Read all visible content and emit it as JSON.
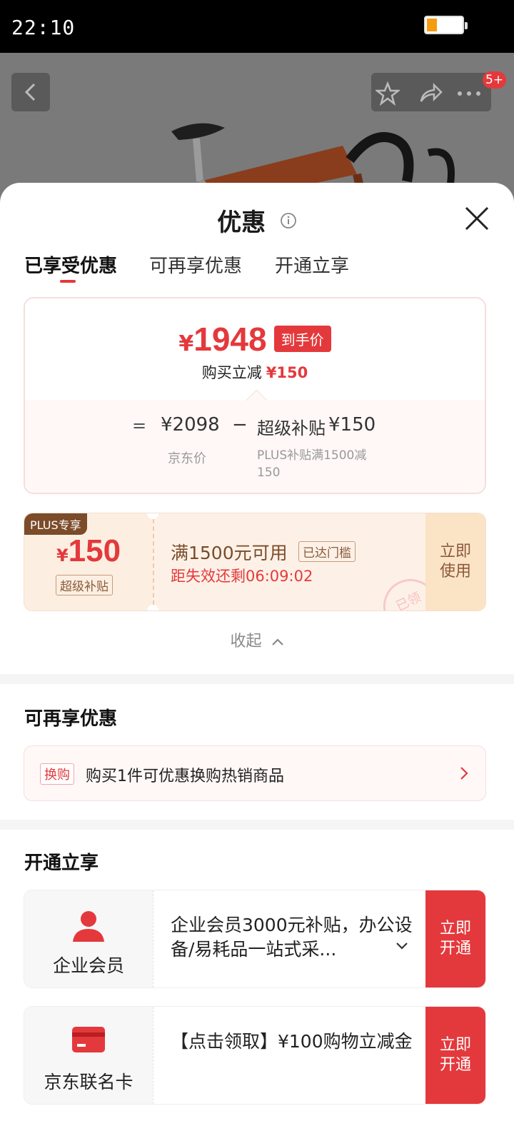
{
  "status_bar": {
    "time": "22:10"
  },
  "product_header": {
    "cart_badge": "5+"
  },
  "sheet": {
    "title": "优惠",
    "tabs": [
      {
        "label": "已享受优惠"
      },
      {
        "label": "可再享优惠"
      },
      {
        "label": "开通立享"
      }
    ],
    "price_card": {
      "currency": "¥",
      "final_price": "1948",
      "final_tag": "到手价",
      "instant_label": "购买立减",
      "instant_amount": "¥150",
      "equals": "=",
      "original_price": "¥2098",
      "minus": "−",
      "subsidy_name": "超级补贴",
      "subsidy_amount": "¥150",
      "original_label": "京东价",
      "subsidy_desc": "PLUS补贴满1500减150"
    },
    "coupon": {
      "plus_tag": "PLUS专享",
      "currency": "¥",
      "amount": "150",
      "type": "超级补贴",
      "condition": "满1500元可用",
      "reached": "已达门槛",
      "timer": "距失效还剩06:09:02",
      "stamp": "已领",
      "use_label": "立即使用"
    },
    "collapse_label": "收起",
    "more_section": {
      "title": "可再享优惠",
      "swap_tag": "换购",
      "swap_text": "购买1件可优惠换购热销商品"
    },
    "open_section": {
      "title": "开通立享",
      "items": [
        {
          "name": "企业会员",
          "desc": "企业会员3000元补贴，办公设备/易耗品一站式采...",
          "button": "立即开通"
        },
        {
          "name": "京东联名卡",
          "desc": "【点击领取】¥100购物立减金",
          "button": "立即开通"
        }
      ]
    }
  },
  "colors": {
    "accent": "#e4393c",
    "coupon_bg": "#fdf1e7",
    "plus_brown": "#7b4b2a"
  }
}
